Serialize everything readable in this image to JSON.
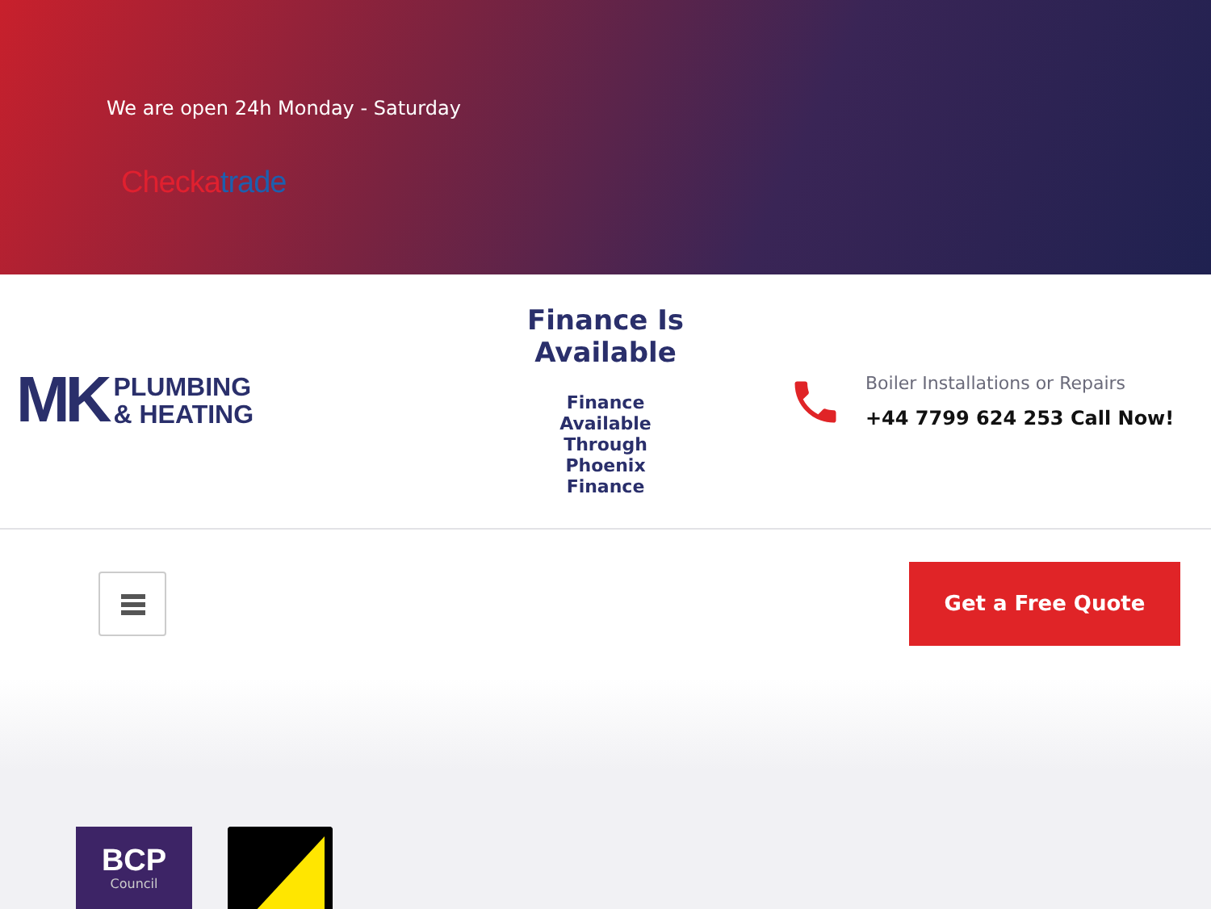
{
  "topbar": {
    "hours": "We are open 24h Monday - Saturday",
    "checkatrade": [
      {
        "text": "Checka",
        "color": "#e0202f"
      },
      {
        "text": "trade",
        "color": "#1d5fae"
      }
    ]
  },
  "header": {
    "logo": {
      "mark": "MK",
      "lines": [
        "PLUMBING",
        "& HEATING"
      ]
    },
    "finance": {
      "title": "Finance Is Available",
      "text": "Finance Available Through Phoenix Finance"
    },
    "contact": {
      "label": "Boiler Installations or Repairs",
      "phone": "+44 7799 624 253 Call Now!"
    }
  },
  "nav": {
    "cta": "Get a Free Quote"
  },
  "badges": [
    {
      "kind": "bcp",
      "title": "BCP",
      "sub": "Council"
    },
    {
      "kind": "gas"
    }
  ]
}
